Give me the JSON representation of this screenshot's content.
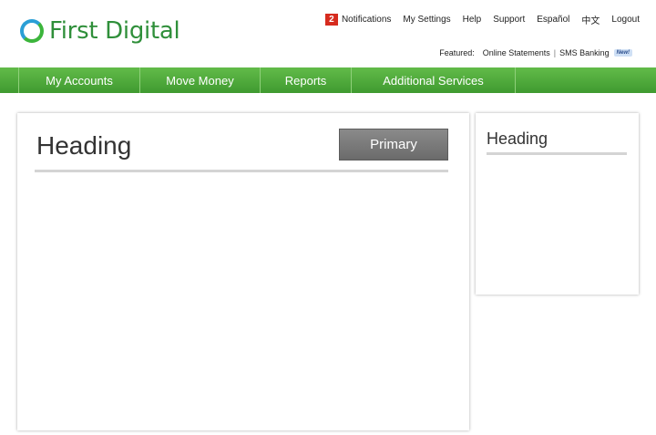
{
  "brand": {
    "name": "First Digital"
  },
  "utility_nav": {
    "notification_count": "2",
    "notifications": "Notifications",
    "my_settings": "My Settings",
    "help": "Help",
    "support": "Support",
    "espanol": "Español",
    "chinese": "中文",
    "logout": "Logout"
  },
  "featured": {
    "label": "Featured:",
    "link1": "Online Statements",
    "separator": "|",
    "link2": "SMS Banking",
    "new_badge": "New!"
  },
  "main_nav": [
    {
      "label": "My Accounts"
    },
    {
      "label": "Move Money"
    },
    {
      "label": "Reports"
    },
    {
      "label": "Additional Services"
    }
  ],
  "main_panel": {
    "heading": "Heading",
    "primary_button": "Primary"
  },
  "side_panel": {
    "heading": "Heading"
  },
  "colors": {
    "nav_green": "#4caf3a",
    "brand_green": "#2f8f3a",
    "badge_red": "#d62b1e",
    "button_gray": "#777777"
  }
}
